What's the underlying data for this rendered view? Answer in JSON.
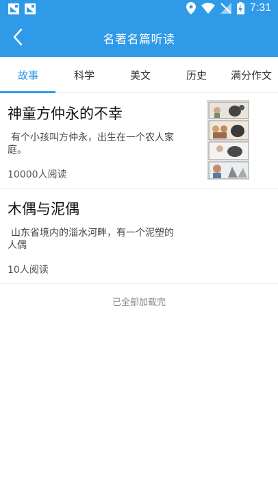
{
  "status_bar": {
    "time": "7:31",
    "icons": [
      "notification-icon",
      "notification-icon",
      "location-icon",
      "wifi-icon",
      "no-signal-icon",
      "battery-charging-icon"
    ]
  },
  "app_bar": {
    "title": "名著名篇听读",
    "back_icon": "back-arrow-icon"
  },
  "tabs": [
    {
      "label": "故事",
      "active": true
    },
    {
      "label": "科学",
      "active": false
    },
    {
      "label": "美文",
      "active": false
    },
    {
      "label": "历史",
      "active": false
    },
    {
      "label": "满分作文",
      "active": false
    }
  ],
  "items": [
    {
      "title": "神童方仲永的不幸",
      "desc": "有个小孩叫方仲永，出生在一个农人家庭。",
      "reads": "10000人阅读",
      "has_thumbnail": true
    },
    {
      "title": "木偶与泥偶",
      "desc": "山东省境内的淄水河畔，有一个泥塑的人偶",
      "reads": "10人阅读",
      "has_thumbnail": false
    }
  ],
  "footer_text": "已全部加载完",
  "colors": {
    "primary": "#2f9ae8",
    "background": "#ffffff"
  }
}
